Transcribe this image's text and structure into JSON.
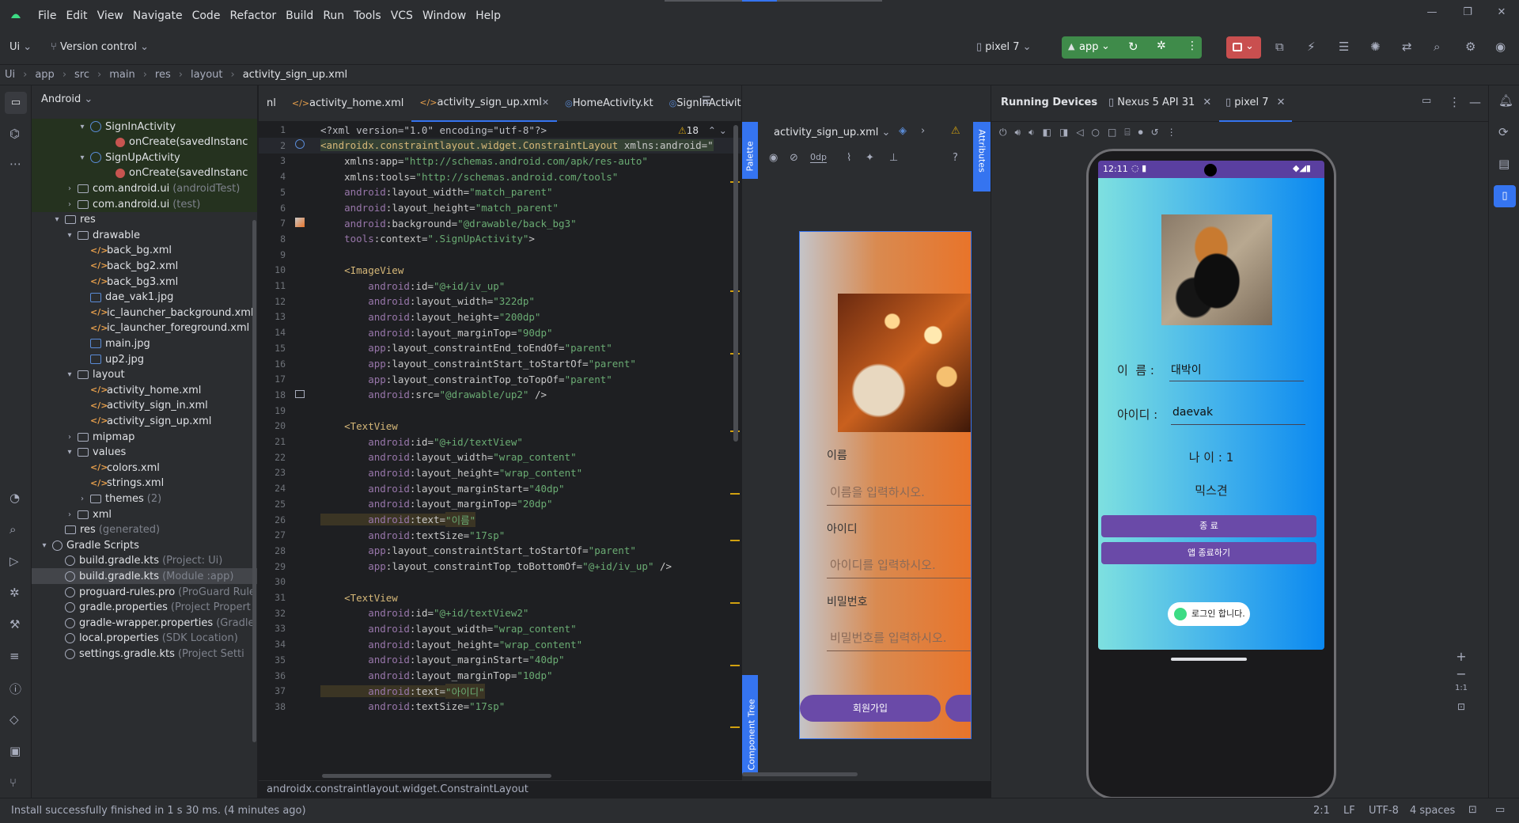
{
  "menu": [
    "File",
    "Edit",
    "View",
    "Navigate",
    "Code",
    "Refactor",
    "Build",
    "Run",
    "Tools",
    "VCS",
    "Window",
    "Help"
  ],
  "toolbar": {
    "project": "Ui",
    "vcs": "Version control",
    "device": "pixel 7",
    "run_config": "app"
  },
  "breadcrumb": [
    "Ui",
    "app",
    "src",
    "main",
    "res",
    "layout",
    "activity_sign_up.xml"
  ],
  "project_panel": {
    "title": "Android",
    "rows": [
      {
        "label": "SignInActivity",
        "sub": "",
        "indent": 4,
        "icon": "class",
        "chev": "▾",
        "hl": true
      },
      {
        "label": "onCreate(savedInstanc",
        "sub": "",
        "indent": 6,
        "icon": "m",
        "chev": "",
        "hl": true
      },
      {
        "label": "SignUpActivity",
        "sub": "",
        "indent": 4,
        "icon": "class",
        "chev": "▾",
        "hl": true
      },
      {
        "label": "onCreate(savedInstanc",
        "sub": "",
        "indent": 6,
        "icon": "m",
        "chev": "",
        "hl": true
      },
      {
        "label": "com.android.ui",
        "sub": "(androidTest)",
        "indent": 3,
        "icon": "folder",
        "chev": "›",
        "hl": true
      },
      {
        "label": "com.android.ui",
        "sub": "(test)",
        "indent": 3,
        "icon": "folder",
        "chev": "›",
        "hl": true
      },
      {
        "label": "res",
        "sub": "",
        "indent": 2,
        "icon": "folder",
        "chev": "▾",
        "hl": false
      },
      {
        "label": "drawable",
        "sub": "",
        "indent": 3,
        "icon": "folder",
        "chev": "▾",
        "hl": false
      },
      {
        "label": "back_bg.xml",
        "sub": "",
        "indent": 4,
        "icon": "xml",
        "chev": "",
        "hl": false
      },
      {
        "label": "back_bg2.xml",
        "sub": "",
        "indent": 4,
        "icon": "xml",
        "chev": "",
        "hl": false
      },
      {
        "label": "back_bg3.xml",
        "sub": "",
        "indent": 4,
        "icon": "xml",
        "chev": "",
        "hl": false
      },
      {
        "label": "dae_vak1.jpg",
        "sub": "",
        "indent": 4,
        "icon": "img",
        "chev": "",
        "hl": false
      },
      {
        "label": "ic_launcher_background.xml",
        "sub": "",
        "indent": 4,
        "icon": "xml",
        "chev": "",
        "hl": false
      },
      {
        "label": "ic_launcher_foreground.xml",
        "sub": "",
        "indent": 4,
        "icon": "xml",
        "chev": "",
        "hl": false
      },
      {
        "label": "main.jpg",
        "sub": "",
        "indent": 4,
        "icon": "img",
        "chev": "",
        "hl": false
      },
      {
        "label": "up2.jpg",
        "sub": "",
        "indent": 4,
        "icon": "img",
        "chev": "",
        "hl": false
      },
      {
        "label": "layout",
        "sub": "",
        "indent": 3,
        "icon": "folder",
        "chev": "▾",
        "hl": false
      },
      {
        "label": "activity_home.xml",
        "sub": "",
        "indent": 4,
        "icon": "xml",
        "chev": "",
        "hl": false
      },
      {
        "label": "activity_sign_in.xml",
        "sub": "",
        "indent": 4,
        "icon": "xml",
        "chev": "",
        "hl": false
      },
      {
        "label": "activity_sign_up.xml",
        "sub": "",
        "indent": 4,
        "icon": "xml",
        "chev": "",
        "hl": false
      },
      {
        "label": "mipmap",
        "sub": "",
        "indent": 3,
        "icon": "folder",
        "chev": "›",
        "hl": false
      },
      {
        "label": "values",
        "sub": "",
        "indent": 3,
        "icon": "folder",
        "chev": "▾",
        "hl": false
      },
      {
        "label": "colors.xml",
        "sub": "",
        "indent": 4,
        "icon": "xml",
        "chev": "",
        "hl": false
      },
      {
        "label": "strings.xml",
        "sub": "",
        "indent": 4,
        "icon": "xml",
        "chev": "",
        "hl": false
      },
      {
        "label": "themes",
        "sub": "(2)",
        "indent": 4,
        "icon": "folder",
        "chev": "›",
        "hl": false
      },
      {
        "label": "xml",
        "sub": "",
        "indent": 3,
        "icon": "folder",
        "chev": "›",
        "hl": false
      },
      {
        "label": "res",
        "sub": "(generated)",
        "indent": 2,
        "icon": "folder",
        "chev": "",
        "hl": false
      },
      {
        "label": "Gradle Scripts",
        "sub": "",
        "indent": 1,
        "icon": "gear",
        "chev": "▾",
        "hl": false
      },
      {
        "label": "build.gradle.kts",
        "sub": "(Project: Ui)",
        "indent": 2,
        "icon": "gear",
        "chev": "",
        "hl": false
      },
      {
        "label": "build.gradle.kts",
        "sub": "(Module :app)",
        "indent": 2,
        "icon": "gear",
        "chev": "",
        "hl": false,
        "sel": true
      },
      {
        "label": "proguard-rules.pro",
        "sub": "(ProGuard Rule",
        "indent": 2,
        "icon": "gear",
        "chev": "",
        "hl": false
      },
      {
        "label": "gradle.properties",
        "sub": "(Project Propert",
        "indent": 2,
        "icon": "gear",
        "chev": "",
        "hl": false
      },
      {
        "label": "gradle-wrapper.properties",
        "sub": "(Gradle",
        "indent": 2,
        "icon": "gear",
        "chev": "",
        "hl": false
      },
      {
        "label": "local.properties",
        "sub": "(SDK Location)",
        "indent": 2,
        "icon": "gear",
        "chev": "",
        "hl": false
      },
      {
        "label": "settings.gradle.kts",
        "sub": "(Project Setti",
        "indent": 2,
        "icon": "gear",
        "chev": "",
        "hl": false
      }
    ]
  },
  "editor_tabs": [
    "nl",
    "activity_home.xml",
    "activity_sign_up.xml",
    "HomeActivity.kt",
    "SignInActivity.kt",
    "SignUpActivit"
  ],
  "active_tab": "activity_sign_up.xml",
  "warnings_count": "18",
  "code_lines": [
    {
      "n": "1",
      "segs": [
        [
          "pi",
          "<?xml version=\"1.0\" encoding=\"utf-8\"?>"
        ]
      ]
    },
    {
      "n": "2",
      "segs": [
        [
          "tag",
          "<androidx.constraintlayout.widget.ConstraintLayout"
        ],
        [
          "attr",
          " xmlns:android=\""
        ]
      ]
    },
    {
      "n": "3",
      "segs": [
        [
          "attr",
          "    xmlns:app="
        ],
        [
          "val",
          "\"http://schemas.android.com/apk/res-auto\""
        ]
      ]
    },
    {
      "n": "4",
      "segs": [
        [
          "attr",
          "    xmlns:tools="
        ],
        [
          "val",
          "\"http://schemas.android.com/tools\""
        ]
      ]
    },
    {
      "n": "5",
      "segs": [
        [
          "ns",
          "    android"
        ],
        [
          "attr",
          ":layout_width="
        ],
        [
          "val",
          "\"match_parent\""
        ]
      ]
    },
    {
      "n": "6",
      "segs": [
        [
          "ns",
          "    android"
        ],
        [
          "attr",
          ":layout_height="
        ],
        [
          "val",
          "\"match_parent\""
        ]
      ]
    },
    {
      "n": "7",
      "segs": [
        [
          "ns",
          "    android"
        ],
        [
          "attr",
          ":background="
        ],
        [
          "val",
          "\"@drawable/back_bg3\""
        ]
      ]
    },
    {
      "n": "8",
      "segs": [
        [
          "ns",
          "    tools"
        ],
        [
          "attr",
          ":context="
        ],
        [
          "val",
          "\".SignUpActivity\""
        ],
        [
          "attr",
          ">"
        ]
      ]
    },
    {
      "n": "9",
      "segs": []
    },
    {
      "n": "10",
      "segs": [
        [
          "tag",
          "    <ImageView"
        ]
      ]
    },
    {
      "n": "11",
      "segs": [
        [
          "ns",
          "        android"
        ],
        [
          "attr",
          ":id="
        ],
        [
          "val",
          "\"@+id/iv_up\""
        ]
      ]
    },
    {
      "n": "12",
      "segs": [
        [
          "ns",
          "        android"
        ],
        [
          "attr",
          ":layout_width="
        ],
        [
          "val",
          "\"322dp\""
        ]
      ]
    },
    {
      "n": "13",
      "segs": [
        [
          "ns",
          "        android"
        ],
        [
          "attr",
          ":layout_height="
        ],
        [
          "val",
          "\"200dp\""
        ]
      ]
    },
    {
      "n": "14",
      "segs": [
        [
          "ns",
          "        android"
        ],
        [
          "attr",
          ":layout_marginTop="
        ],
        [
          "val",
          "\"90dp\""
        ]
      ]
    },
    {
      "n": "15",
      "segs": [
        [
          "ns",
          "        app"
        ],
        [
          "attr",
          ":layout_constraintEnd_toEndOf="
        ],
        [
          "val",
          "\"parent\""
        ]
      ]
    },
    {
      "n": "16",
      "segs": [
        [
          "ns",
          "        app"
        ],
        [
          "attr",
          ":layout_constraintStart_toStartOf="
        ],
        [
          "val",
          "\"parent\""
        ]
      ]
    },
    {
      "n": "17",
      "segs": [
        [
          "ns",
          "        app"
        ],
        [
          "attr",
          ":layout_constraintTop_toTopOf="
        ],
        [
          "val",
          "\"parent\""
        ]
      ]
    },
    {
      "n": "18",
      "segs": [
        [
          "ns",
          "        android"
        ],
        [
          "attr",
          ":src="
        ],
        [
          "val",
          "\"@drawable/up2\""
        ],
        [
          "attr",
          " />"
        ]
      ]
    },
    {
      "n": "19",
      "segs": []
    },
    {
      "n": "20",
      "segs": [
        [
          "tag",
          "    <TextView"
        ]
      ]
    },
    {
      "n": "21",
      "segs": [
        [
          "ns",
          "        android"
        ],
        [
          "attr",
          ":id="
        ],
        [
          "val",
          "\"@+id/textView\""
        ]
      ]
    },
    {
      "n": "22",
      "segs": [
        [
          "ns",
          "        android"
        ],
        [
          "attr",
          ":layout_width="
        ],
        [
          "val",
          "\"wrap_content\""
        ]
      ]
    },
    {
      "n": "23",
      "segs": [
        [
          "ns",
          "        android"
        ],
        [
          "attr",
          ":layout_height="
        ],
        [
          "val",
          "\"wrap_content\""
        ]
      ]
    },
    {
      "n": "24",
      "segs": [
        [
          "ns",
          "        android"
        ],
        [
          "attr",
          ":layout_marginStart="
        ],
        [
          "val",
          "\"40dp\""
        ]
      ]
    },
    {
      "n": "25",
      "segs": [
        [
          "ns",
          "        android"
        ],
        [
          "attr",
          ":layout_marginTop="
        ],
        [
          "val",
          "\"20dp\""
        ]
      ]
    },
    {
      "n": "26",
      "segs": [
        [
          "ns",
          "        android"
        ],
        [
          "attr",
          ":text="
        ],
        [
          "val",
          "\"이름\""
        ]
      ]
    },
    {
      "n": "27",
      "segs": [
        [
          "ns",
          "        android"
        ],
        [
          "attr",
          ":textSize="
        ],
        [
          "val",
          "\"17sp\""
        ]
      ]
    },
    {
      "n": "28",
      "segs": [
        [
          "ns",
          "        app"
        ],
        [
          "attr",
          ":layout_constraintStart_toStartOf="
        ],
        [
          "val",
          "\"parent\""
        ]
      ]
    },
    {
      "n": "29",
      "segs": [
        [
          "ns",
          "        app"
        ],
        [
          "attr",
          ":layout_constraintTop_toBottomOf="
        ],
        [
          "val",
          "\"@+id/iv_up\""
        ],
        [
          "attr",
          " />"
        ]
      ]
    },
    {
      "n": "30",
      "segs": []
    },
    {
      "n": "31",
      "segs": [
        [
          "tag",
          "    <TextView"
        ]
      ]
    },
    {
      "n": "32",
      "segs": [
        [
          "ns",
          "        android"
        ],
        [
          "attr",
          ":id="
        ],
        [
          "val",
          "\"@+id/textView2\""
        ]
      ]
    },
    {
      "n": "33",
      "segs": [
        [
          "ns",
          "        android"
        ],
        [
          "attr",
          ":layout_width="
        ],
        [
          "val",
          "\"wrap_content\""
        ]
      ]
    },
    {
      "n": "34",
      "segs": [
        [
          "ns",
          "        android"
        ],
        [
          "attr",
          ":layout_height="
        ],
        [
          "val",
          "\"wrap_content\""
        ]
      ]
    },
    {
      "n": "35",
      "segs": [
        [
          "ns",
          "        android"
        ],
        [
          "attr",
          ":layout_marginStart="
        ],
        [
          "val",
          "\"40dp\""
        ]
      ]
    },
    {
      "n": "36",
      "segs": [
        [
          "ns",
          "        android"
        ],
        [
          "attr",
          ":layout_marginTop="
        ],
        [
          "val",
          "\"10dp\""
        ]
      ]
    },
    {
      "n": "37",
      "segs": [
        [
          "ns",
          "        android"
        ],
        [
          "attr",
          ":text="
        ],
        [
          "val",
          "\"아이디\""
        ]
      ]
    },
    {
      "n": "38",
      "segs": [
        [
          "ns",
          "        android"
        ],
        [
          "attr",
          ":textSize="
        ],
        [
          "val",
          "\"17sp\""
        ]
      ]
    }
  ],
  "preview": {
    "file": "activity_sign_up.xml",
    "dp": "0dp",
    "palette": "Palette",
    "attributes": "Attributes",
    "component_tree": "Component Tree",
    "label_name": "이름",
    "hint_name": "이름을 입력하시오.",
    "label_id": "아이디",
    "hint_id": "아이디를 입력하시오.",
    "label_pw": "비밀번호",
    "hint_pw": "비밀번호를 입력하시오.",
    "signup_btn": "회원가입"
  },
  "devices": {
    "title": "Running Devices",
    "tabs": [
      "Nexus 5 API 31",
      "pixel 7"
    ],
    "zoom": "1:1"
  },
  "phone": {
    "time": "12:11",
    "name_label": "이  름 :",
    "name_value": "대박이",
    "id_label": "아이디 :",
    "id_value": "daevak",
    "age": "나 이 : 1",
    "breed": "믹스견",
    "btn_exit": "종 료",
    "btn_app_exit": "앱 종료하기",
    "toast": "로그인 합니다."
  },
  "statusbar": {
    "message": "Install successfully finished in 1 s 30 ms. (4 minutes ago)",
    "breadcrumb": "androidx.constraintlayout.widget.ConstraintLayout",
    "pos": "2:1",
    "eol": "LF",
    "enc": "UTF-8",
    "indent": "4 spaces"
  },
  "colors": {
    "accent": "#3574f0",
    "run_green": "#3f8b4a",
    "record_red": "#c94f4f",
    "phone_btn": "#6a4aa8"
  }
}
